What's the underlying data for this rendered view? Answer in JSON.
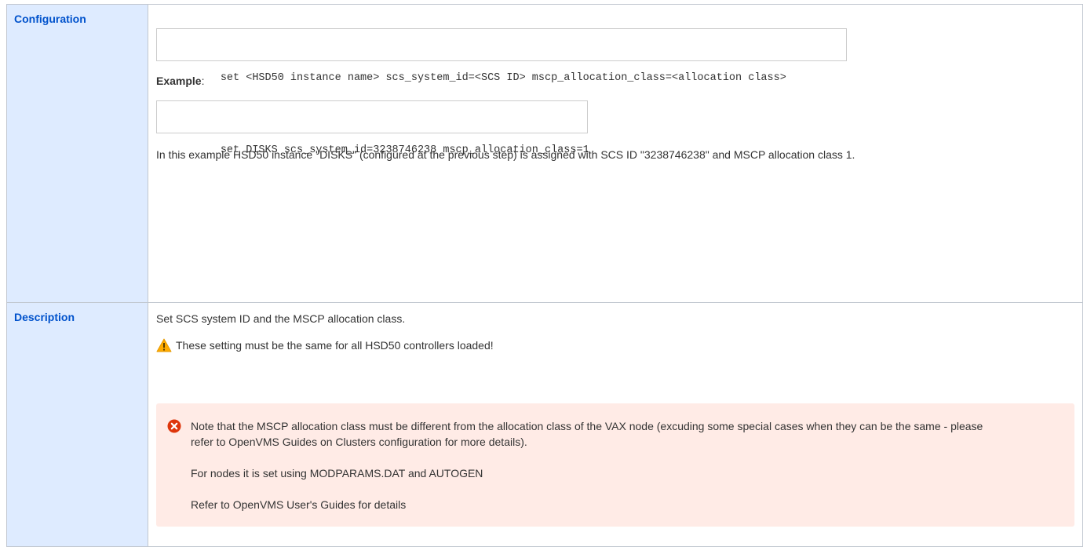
{
  "rows": {
    "configuration": {
      "label": "Configuration",
      "syntax_code": "set <HSD50 instance name> scs_system_id=<SCS ID> mscp_allocation_class=<allocation class>",
      "example_label": "Example",
      "example_colon": ":",
      "example_code": "set DISKS scs_system_id=3238746238 mscp_allocation_class=1",
      "explanation": "In this example HSD50 instance \"DISKS\" (configured at the previous step) is assigned with SCS ID \"3238746238\" and MSCP allocation class 1."
    },
    "description": {
      "label": "Description",
      "text": "Set SCS system ID and the MSCP allocation class.",
      "warning_icon": "warning-triangle-icon",
      "warning_text": "These setting must be the same for all HSD50 controllers loaded!",
      "note": {
        "icon": "error-circle-icon",
        "paragraph_1": "Note that the MSCP allocation class must be different from the allocation class of the VAX node (excuding some special cases when they can be the same - please refer to OpenVMS Guides on Clusters configuration for more details).",
        "paragraph_2": "For nodes it is set using MODPARAMS.DAT and AUTOGEN",
        "paragraph_3": "Refer to OpenVMS User's Guides for details"
      }
    }
  },
  "colors": {
    "label_bg": "#deebff",
    "label_text": "#0052cc",
    "border": "#c1c7d0",
    "error_panel_bg": "#ffebe6",
    "error_icon": "#de350b",
    "warning_icon": "#ffab00"
  }
}
